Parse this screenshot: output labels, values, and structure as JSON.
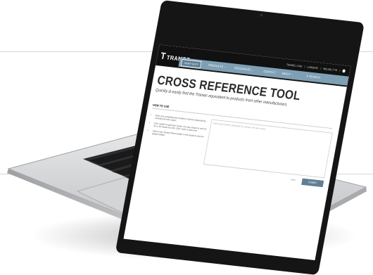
{
  "site": {
    "logo_text": "TRAMEC",
    "top_links": [
      "TRAMEC.COM",
      "/",
      "CAREERS",
      "/",
      "800.336.7778",
      "/"
    ],
    "nav": {
      "heavy_duty": "HEAVY DUTY",
      "products": "PRODUCTS ⌄",
      "resources": "RESOURCES ⌄",
      "contact": "CONTACT",
      "about": "ABOUT ⌄",
      "search": "SEARCH"
    }
  },
  "page": {
    "title": "CROSS REFERENCE TOOL",
    "subtitle": "Quickly & easily find the Tramec equivalent to products from other manufacturers.",
    "how_to_use": "HOW TO USE",
    "steps": [
      "Enter your competitor part numbers in the box separated by commas OR semi colons.",
      "Click \"submit\" to generate results. You may choose to view 10, 20, or 50 results at a time. Click \"reset\" to start over.",
      "Click on any Tramec #/Item number in the results to view the product details."
    ],
    "textarea_placeholder": "Enter part numbers separated by commas OR semi colons",
    "clear_label": "Clear",
    "submit_label": "SUBMIT"
  },
  "colors": {
    "nav_blue": "#7f9fb4",
    "button_blue": "#5f7f95",
    "header_black": "#111111",
    "laptop_silver": "#c9cbce"
  }
}
